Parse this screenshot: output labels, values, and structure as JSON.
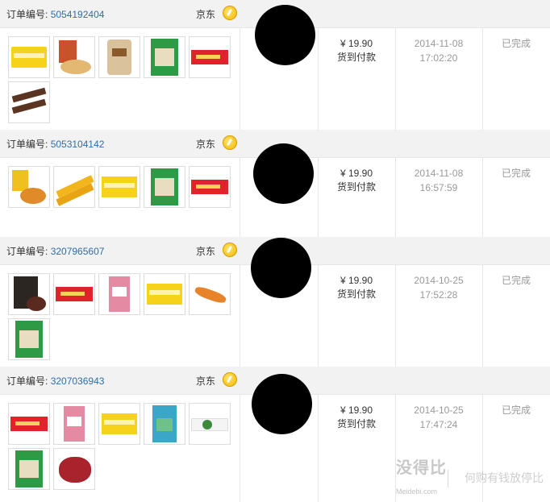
{
  "order_label": "订单编号:",
  "orders": [
    {
      "order_no": "5054192404",
      "shop": "京东",
      "price": "¥ 19.90",
      "payment": "货到付款",
      "date": "2014-11-08",
      "time": "17:02:20",
      "status": "已完成"
    },
    {
      "order_no": "5053104142",
      "shop": "京东",
      "price": "¥ 19.90",
      "payment": "货到付款",
      "date": "2014-11-08",
      "time": "16:57:59",
      "status": "已完成"
    },
    {
      "order_no": "3207965607",
      "shop": "京东",
      "price": "¥ 19.90",
      "payment": "货到付款",
      "date": "2014-10-25",
      "time": "17:52:28",
      "status": "已完成"
    },
    {
      "order_no": "3207036943",
      "shop": "京东",
      "price": "¥ 19.90",
      "payment": "货到付款",
      "date": "2014-10-25",
      "time": "17:47:24",
      "status": "已完成"
    }
  ],
  "colors": {
    "link": "#2f6ea8",
    "header_bg": "#f2f2f2",
    "muted": "#999999"
  },
  "watermark": {
    "brand": "没得比",
    "site": "Meidebi.com",
    "slogan": "何购有钱放停比"
  }
}
